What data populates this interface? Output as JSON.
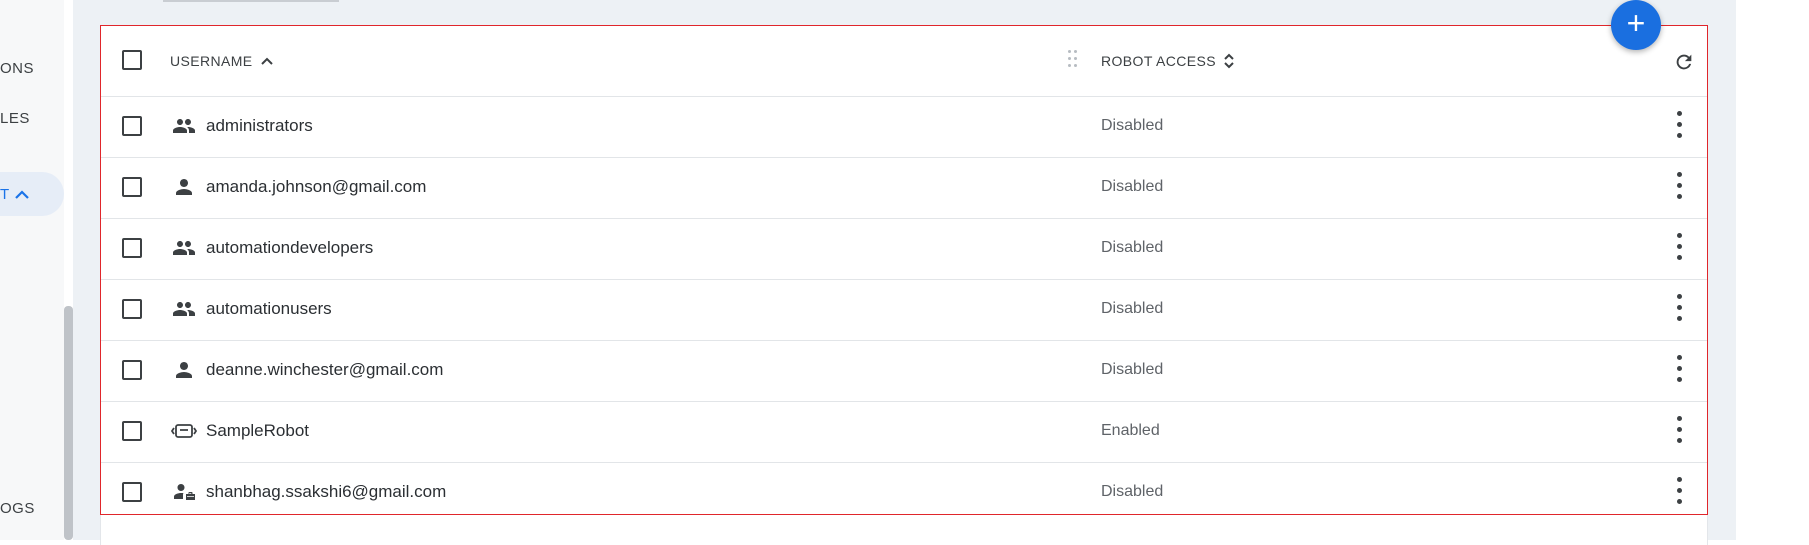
{
  "sidebar": {
    "items": [
      {
        "label": "ONS"
      },
      {
        "label": "LES"
      },
      {
        "label": "T"
      },
      {
        "label": "OGS"
      }
    ]
  },
  "fab": {
    "label": "+"
  },
  "table": {
    "headers": {
      "username": "USERNAME",
      "robot_access": "ROBOT ACCESS"
    },
    "rows": [
      {
        "icon": "group-icon",
        "name": "administrators",
        "access": "Disabled"
      },
      {
        "icon": "person-icon",
        "name": "amanda.johnson@gmail.com",
        "access": "Disabled"
      },
      {
        "icon": "group-icon",
        "name": "automationdevelopers",
        "access": "Disabled"
      },
      {
        "icon": "group-icon",
        "name": "automationusers",
        "access": "Disabled"
      },
      {
        "icon": "person-icon",
        "name": "deanne.winchester@gmail.com",
        "access": "Disabled"
      },
      {
        "icon": "robot-icon",
        "name": "SampleRobot",
        "access": "Enabled"
      },
      {
        "icon": "person-briefcase-icon",
        "name": "shanbhag.ssakshi6@gmail.com",
        "access": "Disabled"
      }
    ]
  },
  "colors": {
    "accent": "#1a73e8",
    "fab": "#1a6fe0",
    "highlight_border": "#e0262b"
  }
}
